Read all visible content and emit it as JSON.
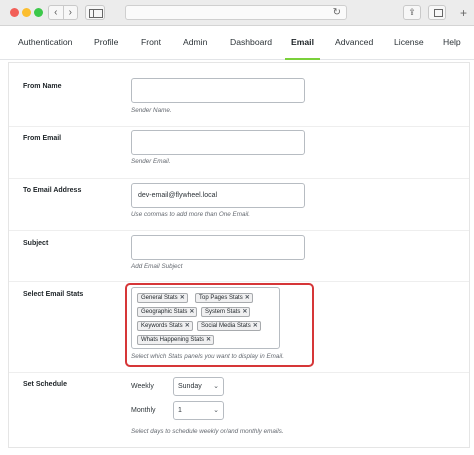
{
  "browser": {
    "nav": {
      "back_icon": "‹",
      "forward_icon": "›"
    },
    "reload_icon": "↻",
    "share_icon": "⇪",
    "new_tab_icon": "+"
  },
  "tabs": [
    {
      "label": "Authentication"
    },
    {
      "label": "Profile"
    },
    {
      "label": "Front"
    },
    {
      "label": "Admin"
    },
    {
      "label": "Dashboard"
    },
    {
      "label": "Email",
      "active": true
    },
    {
      "label": "Advanced"
    },
    {
      "label": "License"
    },
    {
      "label": "Help"
    }
  ],
  "form": {
    "from_name": {
      "label": "From Name",
      "value": "",
      "help": "Sender Name."
    },
    "from_email": {
      "label": "From Email",
      "value": "",
      "help": "Sender Email."
    },
    "to_email": {
      "label": "To Email Address",
      "value": "dev-email@flywheel.local",
      "help": "Use commas to add more than One Email."
    },
    "subject": {
      "label": "Subject",
      "value": "",
      "help": "Add Email Subject"
    },
    "email_stats": {
      "label": "Select Email Stats",
      "tags": [
        "General Stats",
        "Top Pages Stats",
        "Geographic Stats",
        "System Stats",
        "Keywords Stats",
        "Social Media Stats",
        "Whats Happening Stats"
      ],
      "remove_glyph": "✕",
      "help": "Select which Stats panels you want to display in Email."
    },
    "schedule": {
      "label": "Set Schedule",
      "weekly_label": "Weekly",
      "weekly_value": "Sunday",
      "monthly_label": "Monthly",
      "monthly_value": "1",
      "help": "Select days to schedule weekly or/and monthly emails."
    }
  },
  "colors": {
    "highlight": "#d63638",
    "active_tab": "#7ad03a"
  }
}
